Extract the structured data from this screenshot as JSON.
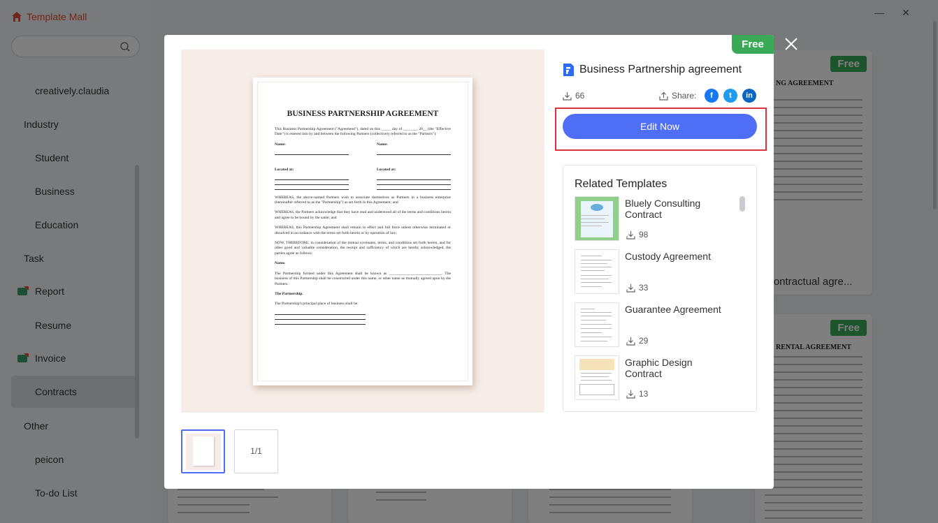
{
  "app": {
    "title": "Template Mall",
    "search_placeholder": "",
    "sidebar_items": [
      {
        "label": "creatively.claudia",
        "level": "sub"
      },
      {
        "label": "Industry",
        "level": "top"
      },
      {
        "label": "Student",
        "level": "sub"
      },
      {
        "label": "Business",
        "level": "sub"
      },
      {
        "label": "Education",
        "level": "sub"
      },
      {
        "label": "Task",
        "level": "top"
      },
      {
        "label": "Report",
        "level": "sub",
        "new": true
      },
      {
        "label": "Resume",
        "level": "sub"
      },
      {
        "label": "Invoice",
        "level": "sub",
        "new": true
      },
      {
        "label": "Contracts",
        "level": "sub",
        "active": true
      },
      {
        "label": "Other",
        "level": "top"
      },
      {
        "label": "peicon",
        "level": "sub"
      },
      {
        "label": "To-do List",
        "level": "sub"
      }
    ],
    "window_controls": {
      "minimize": "—",
      "close": "✕"
    }
  },
  "background_cards": {
    "card1": {
      "badge": "Free",
      "heading": "NG AGREEMENT",
      "title": "Contractual agre..."
    },
    "card2": {
      "badge": "Free",
      "heading": "RENTAL AGREEMENT"
    }
  },
  "modal": {
    "badge": "Free",
    "template_title": "Business Partnership agreement",
    "downloads": "66",
    "share_label": "Share:",
    "edit_button": "Edit Now",
    "page_indicator": "1/1",
    "document": {
      "title": "BUSINESS PARTNERSHIP AGREEMENT",
      "intro": "This Business Partnership Agreement (\"Agreement\"), dated on this _____ day of _______, 20__ (the \"Effective Date\") is entered into by and between the following Partners (collectively referred to as the \"Partners\"):",
      "name_label": "Name:",
      "located_label": "Located at:",
      "whereas1": "WHEREAS, the above-named Partners wish to associate themselves as Partners in a business enterprise (hereinafter referred to as the \"Partnership\") as set forth in this Agreement; and",
      "whereas2": "WHEREAS, the Partners acknowledge that they have read and understood all of the terms and conditions herein and agree to be bound by the same; and",
      "whereas3": "WHEREAS, this Partnership Agreement shall remain in effect and full force unless otherwise terminated or dissolved in accordance with the terms set forth herein or by operation of law;",
      "now": "NOW, THEREFORE, in consideration of the mutual covenants, terms, and conditions set forth herein, and for other good and valuable consideration, the receipt and sufficiency of which are hereby acknowledged, the parties agree as follows:",
      "name_section": "Name.",
      "name_para": "The Partnership formed under this Agreement shall be known as ___________________________. The business of this Partnership shall be constructed under this name, or other name as mutually agreed upon by the Partners.",
      "partnership_section": "The Partnership.",
      "partnership_para": "The Partnership's principal place of business shall be:"
    },
    "related": {
      "heading": "Related Templates",
      "items": [
        {
          "name": "Bluely Consulting Contract",
          "downloads": "98"
        },
        {
          "name": "Custody Agreement",
          "downloads": "33"
        },
        {
          "name": "Guarantee Agreement",
          "downloads": "29"
        },
        {
          "name": "Graphic Design Contract",
          "downloads": "13"
        }
      ]
    }
  }
}
